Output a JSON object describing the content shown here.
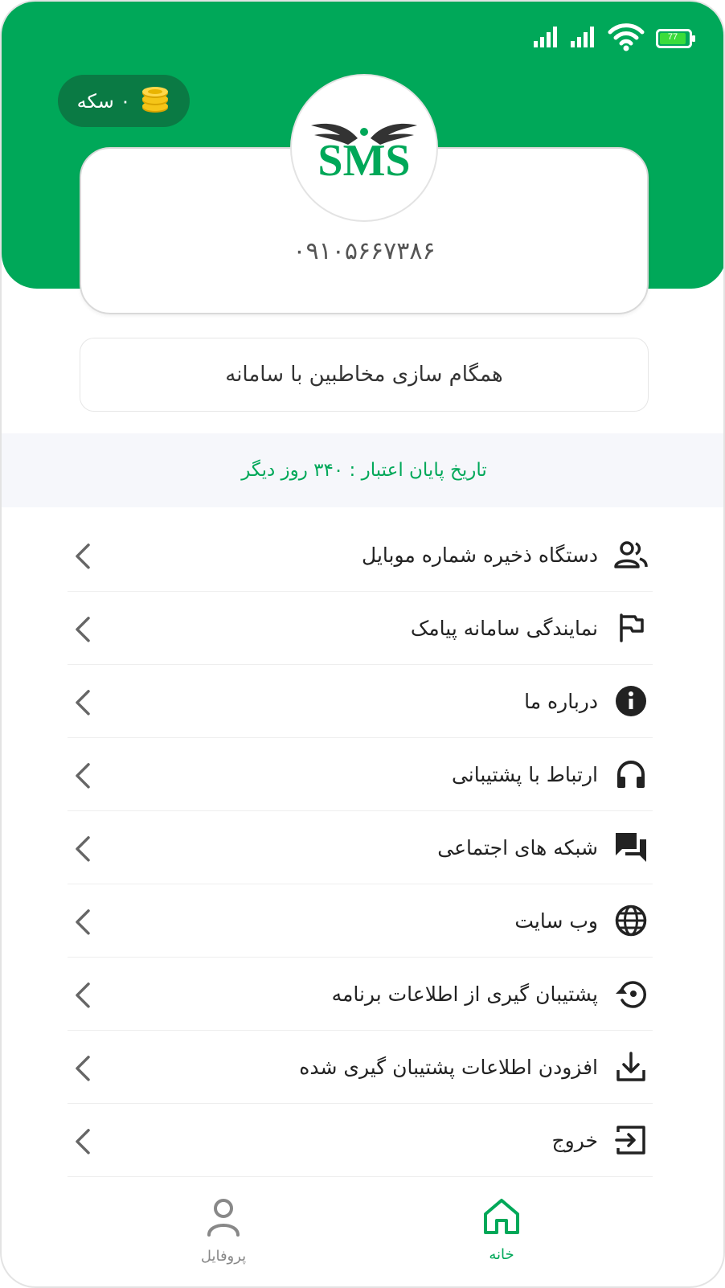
{
  "status_bar": {
    "battery": "77",
    "icons": [
      "signal-icon",
      "signal-icon",
      "wifi-icon",
      "battery-icon"
    ]
  },
  "coins": {
    "label": "۰ سکه",
    "icon": "coins-icon"
  },
  "profile": {
    "logo_text": "SMS",
    "phone": "۰۹۱۰۵۶۶۷۳۸۶"
  },
  "sync_button": {
    "label": "همگام سازی مخاطبین با سامانه"
  },
  "expiry": {
    "text": "تاریخ پایان اعتبار : ۳۴۰ روز دیگر"
  },
  "menu": {
    "items": [
      {
        "label": "دستگاه ذخیره شماره موبایل",
        "icon": "contacts-icon"
      },
      {
        "label": "نمایندگی سامانه پیامک",
        "icon": "flag-icon"
      },
      {
        "label": "درباره ما",
        "icon": "info-icon"
      },
      {
        "label": "ارتباط با پشتیبانی",
        "icon": "headphones-icon"
      },
      {
        "label": "شبکه های اجتماعی",
        "icon": "chat-icon"
      },
      {
        "label": "وب سایت",
        "icon": "globe-icon"
      },
      {
        "label": "پشتیبان گیری از اطلاعات برنامه",
        "icon": "backup-icon"
      },
      {
        "label": "افزودن اطلاعات پشتیبان گیری شده",
        "icon": "download-icon"
      },
      {
        "label": "خروج",
        "icon": "logout-icon"
      }
    ]
  },
  "bottom_nav": {
    "home": {
      "label": "خانه",
      "active": true
    },
    "profile": {
      "label": "پروفایل",
      "active": false
    }
  },
  "colors": {
    "brand": "#00a859",
    "brand_dark": "#0a7a44",
    "text": "#222222",
    "muted": "#888888"
  }
}
